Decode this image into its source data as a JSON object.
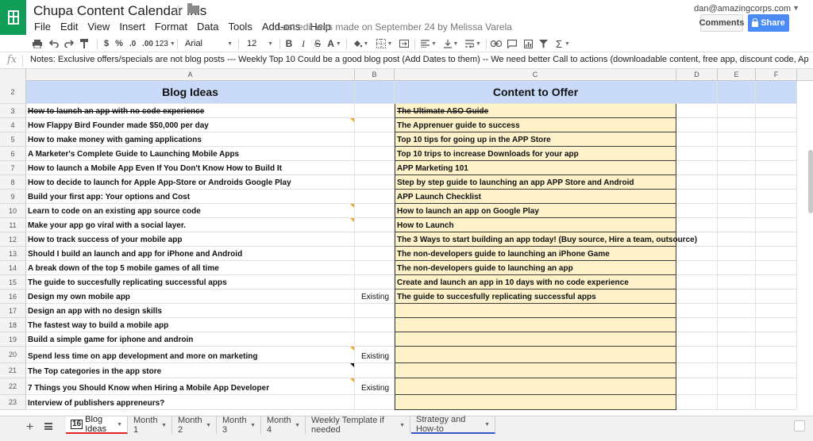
{
  "header": {
    "title": "Chupa Content Calendar .xls",
    "last_edit": "Last edit was made on September 24 by Melissa Varela",
    "user_email": "dan@amazingcorps.com",
    "comments_label": "Comments",
    "share_label": "Share"
  },
  "menu": [
    "File",
    "Edit",
    "View",
    "Insert",
    "Format",
    "Data",
    "Tools",
    "Add-ons",
    "Help"
  ],
  "toolbar": {
    "currency": "$",
    "percent": "%",
    "dec_decrease": ".0",
    "dec_increase": ".00",
    "number_format": "123",
    "font": "Arial",
    "font_size": "12",
    "bold": "B",
    "italic": "I",
    "strike": "S",
    "text_color": "A",
    "sum": "Σ"
  },
  "formula_bar": {
    "fx": "fx",
    "content": "Notes:  Exclusive offers/specials are not blog posts  ---  Weekly Top 10 Could be a good blog post (Add Dates to them)  --    We need better Call to actions (downloadable content, free app, discount code, Apprenuer Guide to success) --"
  },
  "columns": [
    "A",
    "B",
    "C",
    "D",
    "E",
    "F"
  ],
  "sheet": {
    "header_row": {
      "num": "2",
      "a": "Blog Ideas",
      "b": "",
      "c": "Content to Offer"
    },
    "rows": [
      {
        "num": "3",
        "a": "How to launch an app with no code experience",
        "b": "",
        "c": "The Ultimate ASO Guide"
      },
      {
        "num": "4",
        "a": "How Flappy Bird Founder made $50,000 per day",
        "b": "",
        "c": "The Apprenuer guide to success"
      },
      {
        "num": "5",
        "a": "How to make money with gaming applications",
        "b": "",
        "c": "Top 10 tips for going up in the APP Store"
      },
      {
        "num": "6",
        "a": "A Marketer's Complete Guide to Launching Mobile Apps",
        "b": "",
        "c": "Top 10 trips to increase Downloads for your app"
      },
      {
        "num": "7",
        "a": "How to launch  a Mobile App Even If You Don't Know How to Build It",
        "b": "",
        "c": "APP Marketing 101"
      },
      {
        "num": "8",
        "a": "How to decide to launch for Apple App-Store or Androids Google Play",
        "b": "",
        "c": "Step by step guide to launching an app APP Store and Android"
      },
      {
        "num": "9",
        "a": "Build your first app: Your options and Cost",
        "b": "",
        "c": "APP Launch Checklist"
      },
      {
        "num": "10",
        "a": "Learn to code on an existing app source code",
        "b": "",
        "c": "How to launch an app on Google Play"
      },
      {
        "num": "11",
        "a": "Make your app go viral with a social layer.",
        "b": "",
        "c": "How to Launch"
      },
      {
        "num": "12",
        "a": "How to track success of your mobile app",
        "b": "",
        "c": "The 3 Ways to start building an app today!  (Buy source, Hire a team, outsource)"
      },
      {
        "num": "13",
        "a": "Should I build an launch and app for iPhone and Android",
        "b": "",
        "c": "The non-developers guide to launching an iPhone Game"
      },
      {
        "num": "14",
        "a": "A break down of the top 5 mobile games of all time",
        "b": "",
        "c": "The non-developers guide to launching an app"
      },
      {
        "num": "15",
        "a": "The guide to succesfully replicating successful apps",
        "b": "",
        "c": "Create and launch an app in 10 days with no code experience"
      },
      {
        "num": "16",
        "a": "Design my own mobile app",
        "b": "Existing",
        "c": "The guide to succesfully replicating successful apps"
      },
      {
        "num": "17",
        "a": "Design an app with no design skills",
        "b": "",
        "c": ""
      },
      {
        "num": "18",
        "a": "The fastest way to build a mobile app",
        "b": "",
        "c": ""
      },
      {
        "num": "19",
        "a": "Build a simple game for iphone and androin",
        "b": "",
        "c": ""
      },
      {
        "num": "20",
        "a": "Spend less time on app development and more on marketing",
        "b": "Existing",
        "c": ""
      },
      {
        "num": "21",
        "a": "The Top categories in the app store",
        "b": "",
        "c": ""
      },
      {
        "num": "22",
        "a": "7 Things you Should Know when Hiring a Mobile App Developer",
        "b": "Existing",
        "c": ""
      },
      {
        "num": "23",
        "a": "Interview of publishers appreneurs?",
        "b": "",
        "c": ""
      }
    ]
  },
  "tabs": {
    "active_num": "16",
    "items": [
      "Blog Ideas",
      "Month 1",
      "Month 2",
      "Month 3",
      "Month 4",
      "Weekly Template if needed",
      "Strategy and How-to"
    ]
  },
  "colors": {
    "brand_green": "#0f9d58",
    "share_blue": "#4a8af4",
    "header_fill": "#c9daf8",
    "offer_fill": "#fdf1c9",
    "note_marker": "#f4a22b",
    "active_tab_underline": "#e02424",
    "strategy_tab_underline": "#3357c7"
  }
}
